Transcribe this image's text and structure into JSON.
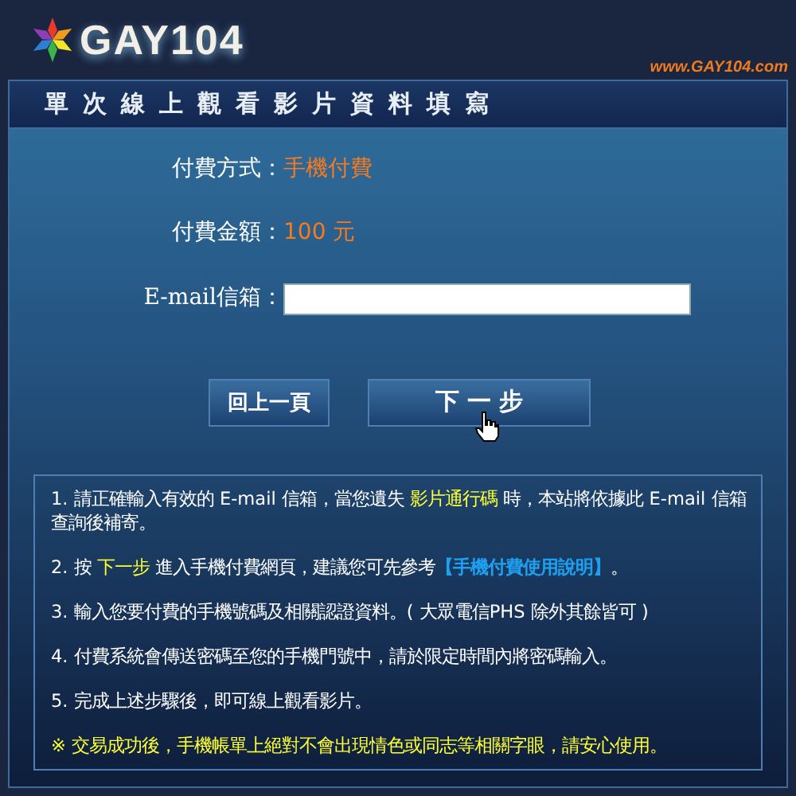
{
  "header": {
    "logo_text": "GAY104",
    "site_url": "www.GAY104.com"
  },
  "title": "單次線上觀看影片資料填寫",
  "form": [
    {
      "kind": "value",
      "label": "付費方式：",
      "value": "手機付費"
    },
    {
      "kind": "value",
      "label": "付費金額：",
      "value": "100 元"
    },
    {
      "kind": "input",
      "label": "E-mail信箱："
    }
  ],
  "buttons": [
    {
      "label": "回上一頁",
      "kind": "secondary"
    },
    {
      "label": "下 一 步",
      "kind": "primary",
      "hovered": true
    }
  ],
  "notes": [
    {
      "kind": "plain",
      "parts": [
        {
          "kind": "text",
          "text": "1. 請正確輸入有效的 E-mail 信箱，當您遺失 "
        },
        {
          "kind": "highlight",
          "text": "影片通行碼"
        },
        {
          "kind": "text",
          "text": " 時，本站將依據此 E-mail 信箱查詢後補寄。"
        }
      ]
    },
    {
      "kind": "plain",
      "parts": [
        {
          "kind": "text",
          "text": "2. 按 "
        },
        {
          "kind": "highlight",
          "text": "下一步"
        },
        {
          "kind": "text",
          "text": " 進入手機付費網頁，建議您可先參考"
        },
        {
          "kind": "link",
          "text": "【手機付費使用說明】"
        },
        {
          "kind": "text",
          "text": "。"
        }
      ]
    },
    {
      "kind": "plain",
      "parts": [
        {
          "kind": "text",
          "text": "3. 輸入您要付費的手機號碼及相關認證資料。( 大眾電信PHS 除外其餘皆可 )"
        }
      ]
    },
    {
      "kind": "plain",
      "parts": [
        {
          "kind": "text",
          "text": "4. 付費系統會傳送密碼至您的手機門號中，請於限定時間內將密碼輸入。"
        }
      ]
    },
    {
      "kind": "plain",
      "parts": [
        {
          "kind": "text",
          "text": "5. 完成上述步驟後，即可線上觀看影片。"
        }
      ]
    },
    {
      "kind": "warning",
      "parts": [
        {
          "kind": "text",
          "text": "※ 交易成功後，手機帳單上絕對不會出現情色或同志等相關字眼，請安心使用。"
        }
      ]
    }
  ]
}
